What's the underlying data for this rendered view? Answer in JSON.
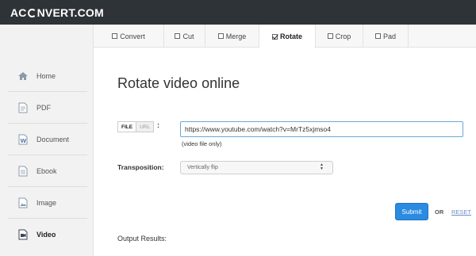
{
  "logo": {
    "prefix": "AC",
    "suffix": "NVERT.COM"
  },
  "sidebar": {
    "items": [
      {
        "label": "Home",
        "icon": "home-icon"
      },
      {
        "label": "PDF",
        "icon": "pdf-icon"
      },
      {
        "label": "Document",
        "icon": "document-icon"
      },
      {
        "label": "Ebook",
        "icon": "ebook-icon"
      },
      {
        "label": "Image",
        "icon": "image-icon"
      },
      {
        "label": "Video",
        "icon": "video-icon",
        "active": true
      }
    ]
  },
  "tabs": [
    {
      "label": "Convert",
      "checked": false
    },
    {
      "label": "Cut",
      "checked": false
    },
    {
      "label": "Merge",
      "checked": false
    },
    {
      "label": "Rotate",
      "checked": true
    },
    {
      "label": "Crop",
      "checked": false
    },
    {
      "label": "Pad",
      "checked": false
    }
  ],
  "main": {
    "title": "Rotate video online",
    "source_toggle": {
      "file": "FILE",
      "url": "URL",
      "colon": ":"
    },
    "url_value": "https://www.youtube.com/watch?v=MrTz5xjmso4",
    "hint": "(video file only)",
    "transposition_label": "Transposition:",
    "transposition_value": "Vertically flip",
    "submit": "Submit",
    "or": "OR",
    "reset": "RESET",
    "output_label": "Output Results:"
  },
  "colors": {
    "topbar": "#2e3338",
    "accent": "#2a8be0",
    "link": "#6a8fc7"
  }
}
